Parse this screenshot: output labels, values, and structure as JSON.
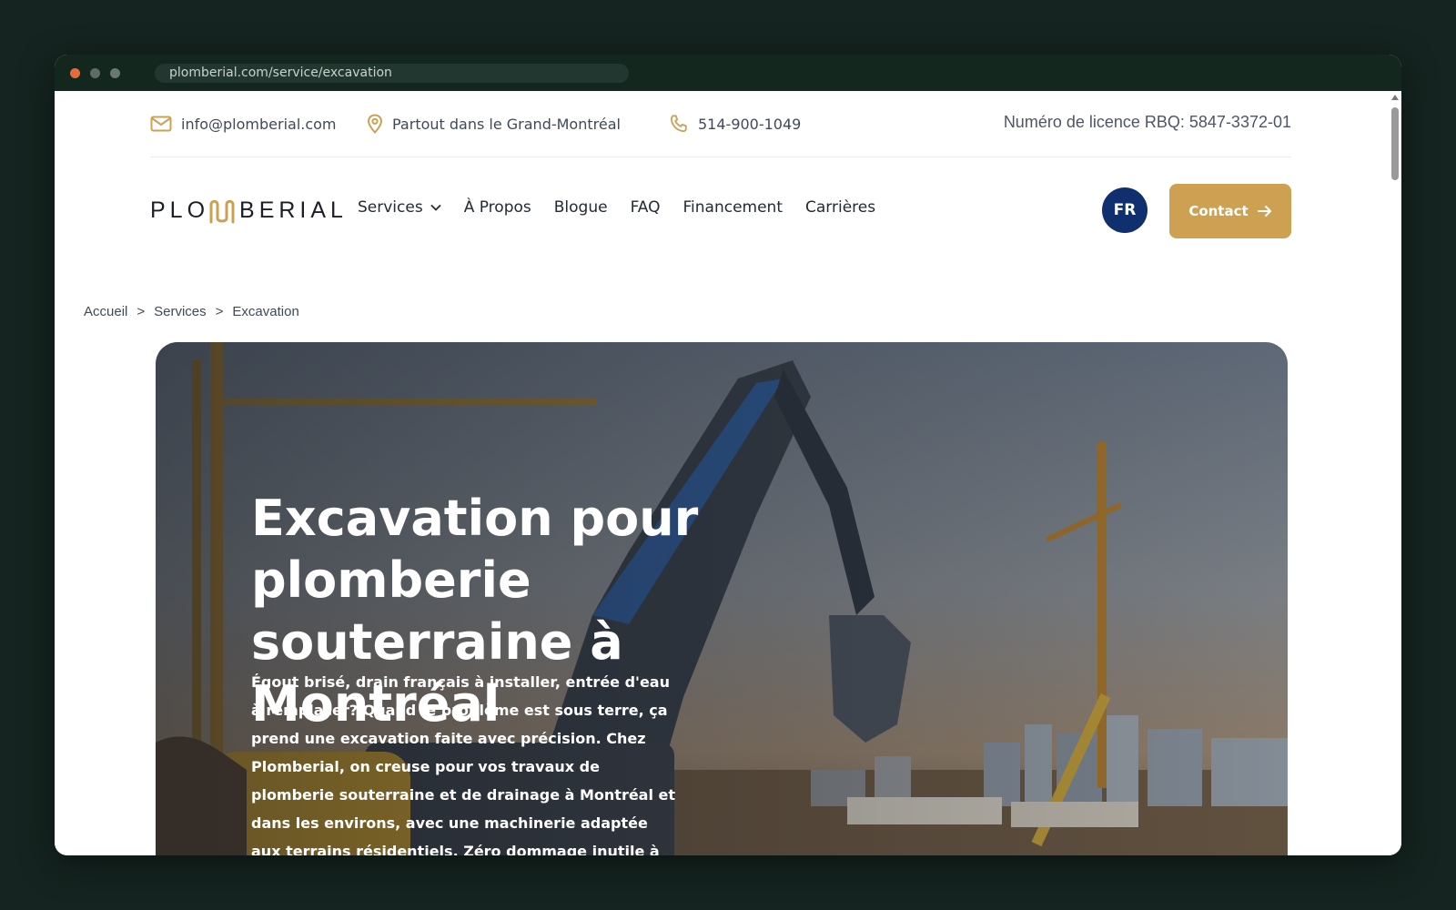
{
  "browser": {
    "url": "plomberial.com/service/excavation"
  },
  "topbar": {
    "email": "info@plomberial.com",
    "location": "Partout dans le Grand-Montréal",
    "phone": "514-900-1049",
    "license": "Numéro de licence RBQ: 5847-3372-01"
  },
  "nav": {
    "logo_left": "PLO",
    "logo_right": "BERIAL",
    "items": [
      {
        "label": "Services"
      },
      {
        "label": "À Propos"
      },
      {
        "label": "Blogue"
      },
      {
        "label": "FAQ"
      },
      {
        "label": "Financement"
      },
      {
        "label": "Carrières"
      }
    ],
    "lang": "FR",
    "contact_label": "Contact"
  },
  "breadcrumb": {
    "items": [
      "Accueil",
      "Services",
      "Excavation"
    ],
    "separator": ">"
  },
  "hero": {
    "title": "Excavation pour plomberie souterraine à Montréal",
    "description": "Égout brisé, drain français à installer, entrée d'eau à remplacer? Quand le problème est sous terre, ça prend une excavation faite avec précision. Chez Plomberial, on creuse pour vos travaux de plomberie souterraine et de drainage à Montréal et dans les environs, avec une machinerie adaptée aux terrains résidentiels. Zéro dommage inutile à votre cour, et on remet tout en ordre"
  },
  "colors": {
    "accent": "#cda052",
    "navy": "#0f2f6e",
    "chrome": "#14271f"
  }
}
